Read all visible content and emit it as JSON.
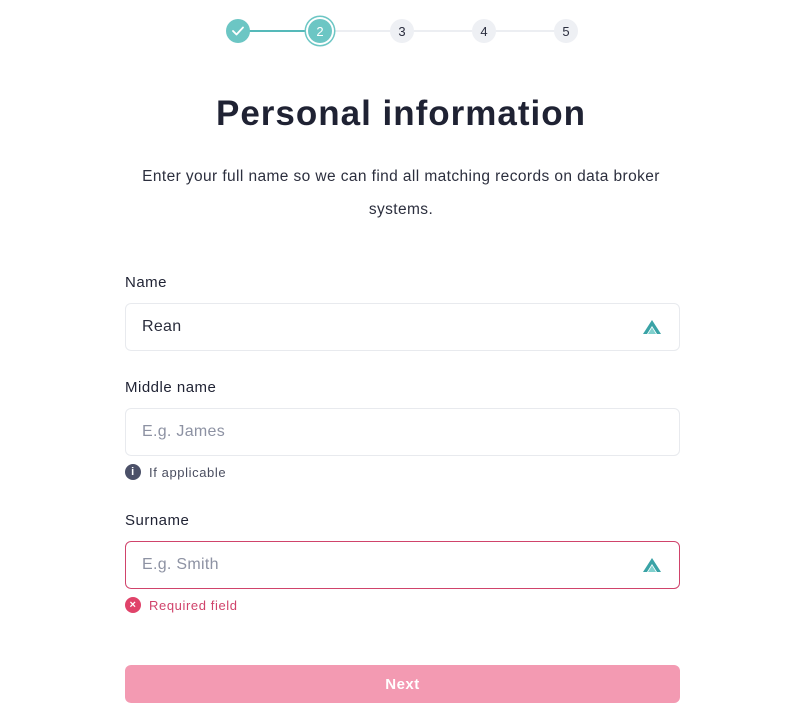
{
  "stepper": {
    "steps": [
      {
        "label": "",
        "state": "done",
        "icon": "check-icon"
      },
      {
        "label": "2",
        "state": "current"
      },
      {
        "label": "3",
        "state": "upcoming"
      },
      {
        "label": "4",
        "state": "upcoming"
      },
      {
        "label": "5",
        "state": "upcoming"
      }
    ],
    "accent_color": "#6cc6c4"
  },
  "page": {
    "title": "Personal information",
    "subtitle": "Enter your full name so we can find all matching records on data broker systems."
  },
  "form": {
    "name": {
      "label": "Name",
      "value": "Rean",
      "placeholder": "",
      "icon": "nordpass-logo-icon"
    },
    "middle_name": {
      "label": "Middle name",
      "value": "",
      "placeholder": "E.g. James",
      "hint": "If applicable",
      "hint_icon": "info-icon"
    },
    "surname": {
      "label": "Surname",
      "value": "",
      "placeholder": "E.g. Smith",
      "icon": "nordpass-logo-icon",
      "error": "Required field",
      "error_icon": "error-x-icon",
      "error_color": "#d0436b"
    }
  },
  "actions": {
    "next_label": "Next",
    "next_color": "#f39ab2"
  }
}
